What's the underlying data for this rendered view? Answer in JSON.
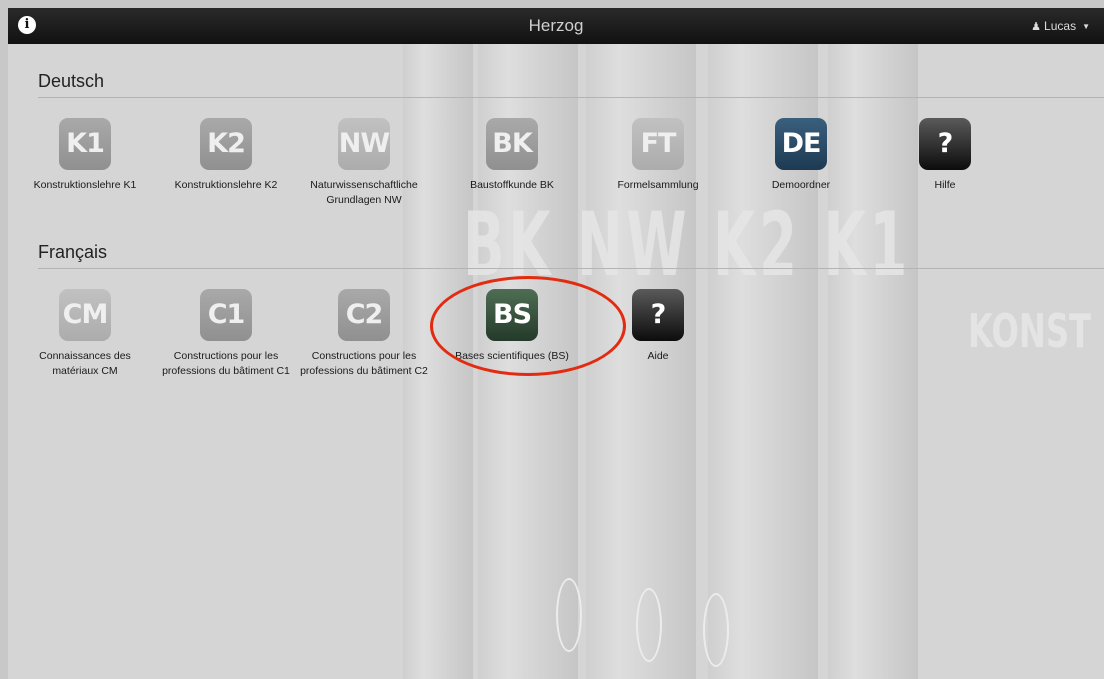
{
  "header": {
    "title": "Herzog",
    "user_name": "Lucas"
  },
  "background_text": {
    "letters": "BK NW K2 K1",
    "konst": "KONST"
  },
  "sections": [
    {
      "title": "Deutsch",
      "items": [
        {
          "icon": "K1",
          "label": "Konstruktionslehre K1"
        },
        {
          "icon": "K2",
          "label": "Konstruktionslehre K2"
        },
        {
          "icon": "NW",
          "label": "Naturwissenschaftliche Grundlagen NW"
        },
        {
          "icon": "BK",
          "label": "Baustoffkunde BK"
        },
        {
          "icon": "FT",
          "label": "Formelsammlung"
        },
        {
          "icon": "DE",
          "label": "Demoordner"
        },
        {
          "icon": "?",
          "label": "Hilfe"
        }
      ]
    },
    {
      "title": "Français",
      "items": [
        {
          "icon": "CM",
          "label": "Connaissances des matériaux CM"
        },
        {
          "icon": "C1",
          "label": "Constructions pour les professions du bâtiment C1"
        },
        {
          "icon": "C2",
          "label": "Constructions pour les professions du bâtiment C2"
        },
        {
          "icon": "BS",
          "label": "Bases scientifiques (BS)"
        },
        {
          "icon": "?",
          "label": "Aide"
        }
      ]
    }
  ],
  "colors": {
    "highlight": "#e22b10",
    "demo_blue": "#2a4a66",
    "bs_green": "#33503a"
  }
}
